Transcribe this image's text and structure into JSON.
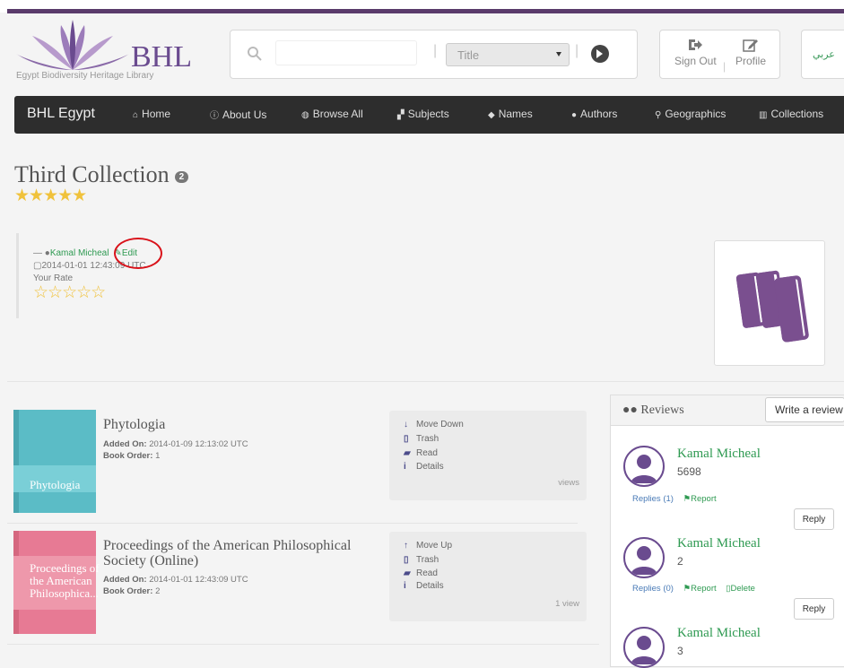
{
  "header": {
    "logo_text": "BHL",
    "logo_sub": "Egypt Biodiversity Heritage Library",
    "search": {
      "placeholder": "",
      "select_value": "Title"
    },
    "user_menu": {
      "sign_out": "Sign Out",
      "profile": "Profile"
    },
    "language": "عربي"
  },
  "nav": {
    "brand": "BHL Egypt",
    "items": [
      "Home",
      "About Us",
      "Browse All",
      "Subjects",
      "Names",
      "Authors",
      "Geographics",
      "Collections"
    ]
  },
  "collection": {
    "title": "Third Collection",
    "count": "2",
    "rating_stars": "★★★★★",
    "author_prefix": "—",
    "author": "Kamal Micheal",
    "edit_label": "Edit",
    "date": "2014-01-01 12:43:09 UTC",
    "your_rate_label": "Your Rate",
    "your_rate_stars": "☆☆☆☆☆"
  },
  "items": [
    {
      "cover_title": "Phytologia",
      "title": "Phytologia",
      "added_on_label": "Added On:",
      "added_on": "2014-01-09 12:13:02 UTC",
      "book_order_label": "Book Order:",
      "book_order": "1",
      "actions": [
        "Move Down",
        "Trash",
        "Read",
        "Details"
      ],
      "views": "views"
    },
    {
      "cover_title": "Proceedings of the American Philosophica...",
      "title": "Proceedings of the American Philosophical Society (Online)",
      "added_on_label": "Added On:",
      "added_on": "2014-01-01 12:43:09 UTC",
      "book_order_label": "Book Order:",
      "book_order": "2",
      "actions": [
        "Move Up",
        "Trash",
        "Read",
        "Details"
      ],
      "views": "1 view"
    }
  ],
  "reviews": {
    "title": "Reviews",
    "write_button": "Write a review",
    "list": [
      {
        "name": "Kamal Micheal",
        "text": "5698",
        "replies": "Replies (1)",
        "report": "Report",
        "reply": "Reply"
      },
      {
        "name": "Kamal Micheal",
        "text": "2",
        "replies": "Replies (0)",
        "report": "Report",
        "delete": "Delete",
        "reply": "Reply"
      },
      {
        "name": "Kamal Micheal",
        "text": "3"
      }
    ]
  },
  "colors": {
    "brand_purple": "#6a4b8f",
    "nav_bg": "#2d2d2d",
    "link_green": "#2f9a52",
    "annotation_red": "#d9121a",
    "cover_teal": "#5bbcc6",
    "cover_pink": "#e77a94"
  }
}
